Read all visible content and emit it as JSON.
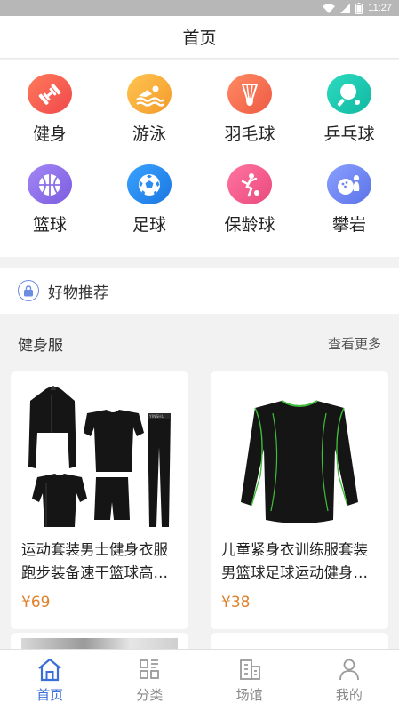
{
  "status_bar": {
    "time": "11:27"
  },
  "header": {
    "title": "首页"
  },
  "sports": [
    {
      "label": "健身",
      "icon": "dumbbell-icon",
      "color": "#f0584a"
    },
    {
      "label": "游泳",
      "icon": "swimmer-icon",
      "color": "#f7a435"
    },
    {
      "label": "羽毛球",
      "icon": "shuttlecock-icon",
      "color": "#f06b4a"
    },
    {
      "label": "乒乓球",
      "icon": "ping-pong-icon",
      "color": "#19c9b0"
    },
    {
      "label": "篮球",
      "icon": "basketball-icon",
      "color": "#8b6ee8"
    },
    {
      "label": "足球",
      "icon": "football-icon",
      "color": "#2b8df0"
    },
    {
      "label": "保龄球",
      "icon": "bowling-icon",
      "color": "#f0588e"
    },
    {
      "label": "攀岩",
      "icon": "climbing-icon",
      "color": "#6f86f0"
    }
  ],
  "recommend": {
    "label": "好物推荐"
  },
  "section": {
    "title": "健身服",
    "more": "查看更多"
  },
  "products": [
    {
      "name": "运动套装男士健身衣服跑步装备速干篮球高弹紧身衣训练服",
      "price": "¥69"
    },
    {
      "name": "儿童紧身衣训练服套装男篮球足球运动健身长袖",
      "price": "¥38"
    }
  ],
  "tabs": [
    {
      "label": "首页",
      "icon": "home-icon",
      "active": true
    },
    {
      "label": "分类",
      "icon": "category-icon",
      "active": false
    },
    {
      "label": "场馆",
      "icon": "venue-icon",
      "active": false
    },
    {
      "label": "我的",
      "icon": "profile-icon",
      "active": false
    }
  ],
  "colors": {
    "accent": "#3a6fd8",
    "price": "#e0802b"
  }
}
